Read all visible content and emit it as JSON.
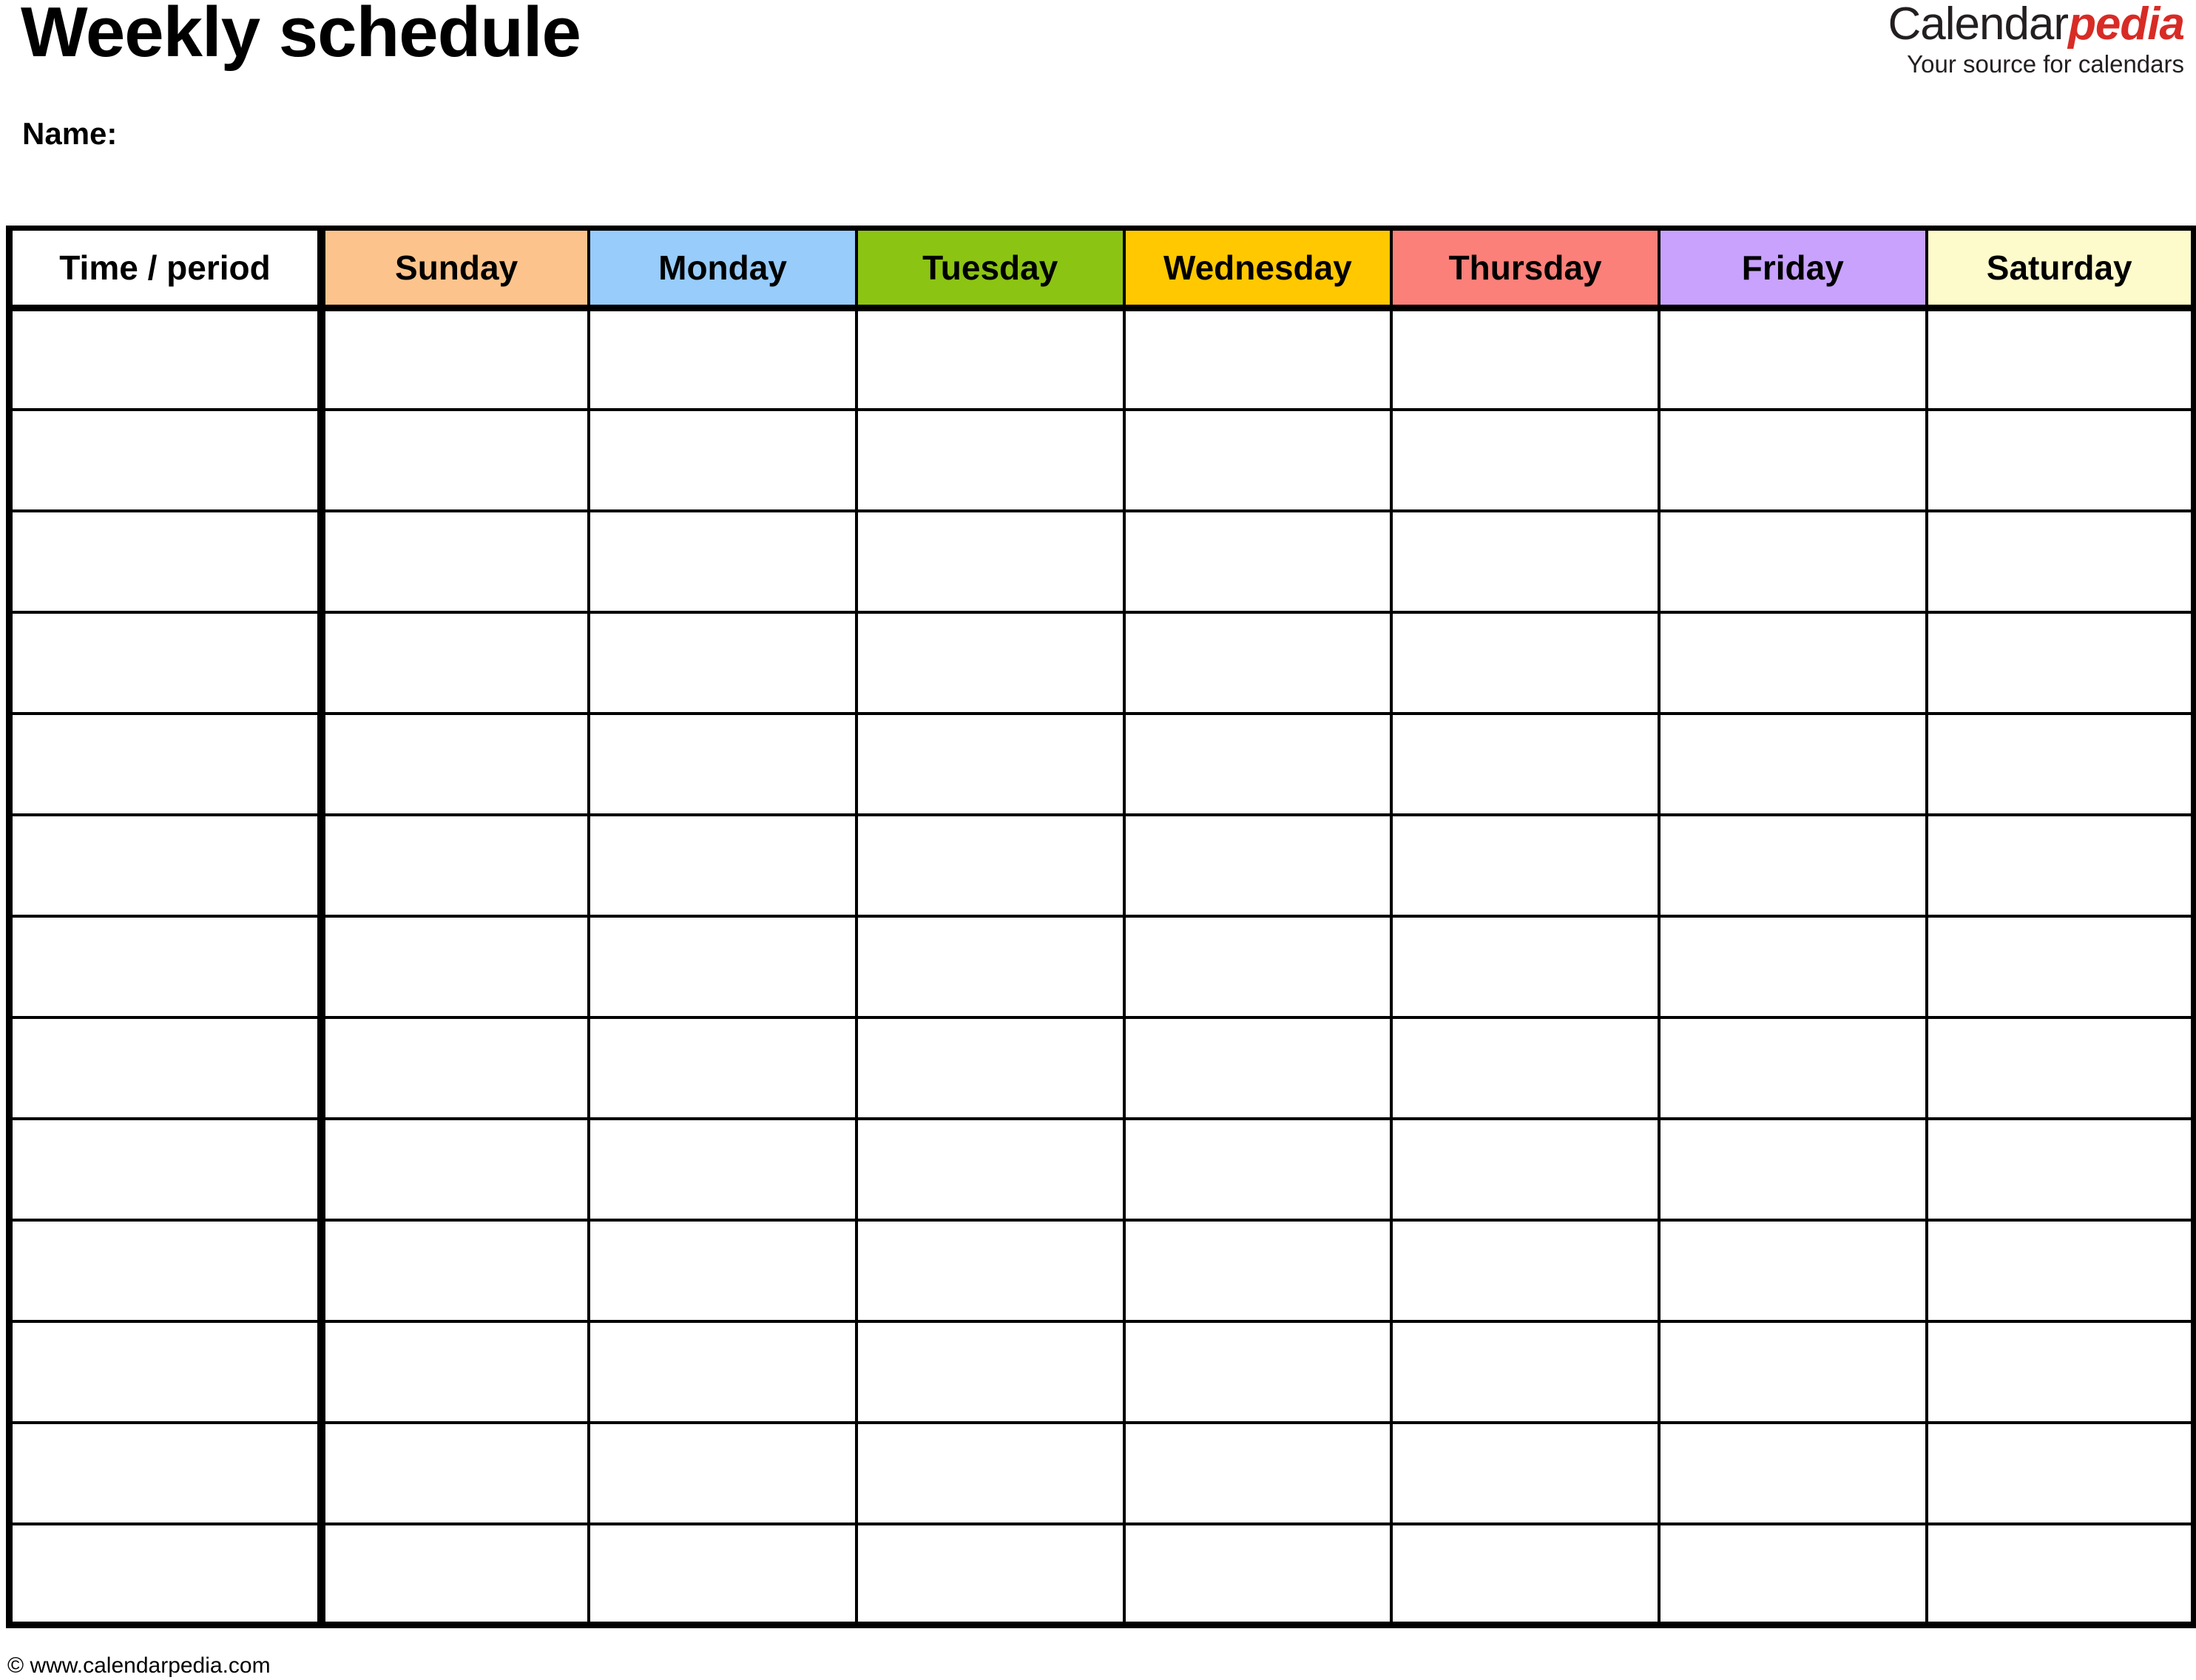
{
  "document": {
    "title": "Weekly schedule",
    "name_label": "Name:"
  },
  "brand": {
    "part1": "Calendar",
    "part2": "pedia",
    "tagline": "Your source for calendars",
    "accent_color": "#d82b26",
    "text_color": "#231f20"
  },
  "table": {
    "time_column_header": "Time / period",
    "columns": [
      {
        "label": "Sunday",
        "color": "#FCC48C"
      },
      {
        "label": "Monday",
        "color": "#97CCFB"
      },
      {
        "label": "Tuesday",
        "color": "#8CC413"
      },
      {
        "label": "Wednesday",
        "color": "#FFC800"
      },
      {
        "label": "Thursday",
        "color": "#FB8079"
      },
      {
        "label": "Friday",
        "color": "#C8A2FC"
      },
      {
        "label": "Saturday",
        "color": "#FDFBCB"
      }
    ],
    "body_row_count": 13,
    "cell_values": [
      [
        "",
        "",
        "",
        "",
        "",
        "",
        "",
        ""
      ],
      [
        "",
        "",
        "",
        "",
        "",
        "",
        "",
        ""
      ],
      [
        "",
        "",
        "",
        "",
        "",
        "",
        "",
        ""
      ],
      [
        "",
        "",
        "",
        "",
        "",
        "",
        "",
        ""
      ],
      [
        "",
        "",
        "",
        "",
        "",
        "",
        "",
        ""
      ],
      [
        "",
        "",
        "",
        "",
        "",
        "",
        "",
        ""
      ],
      [
        "",
        "",
        "",
        "",
        "",
        "",
        "",
        ""
      ],
      [
        "",
        "",
        "",
        "",
        "",
        "",
        "",
        ""
      ],
      [
        "",
        "",
        "",
        "",
        "",
        "",
        "",
        ""
      ],
      [
        "",
        "",
        "",
        "",
        "",
        "",
        "",
        ""
      ],
      [
        "",
        "",
        "",
        "",
        "",
        "",
        "",
        ""
      ],
      [
        "",
        "",
        "",
        "",
        "",
        "",
        "",
        ""
      ],
      [
        "",
        "",
        "",
        "",
        "",
        "",
        "",
        ""
      ]
    ]
  },
  "footer": {
    "copyright": "© www.calendarpedia.com"
  }
}
